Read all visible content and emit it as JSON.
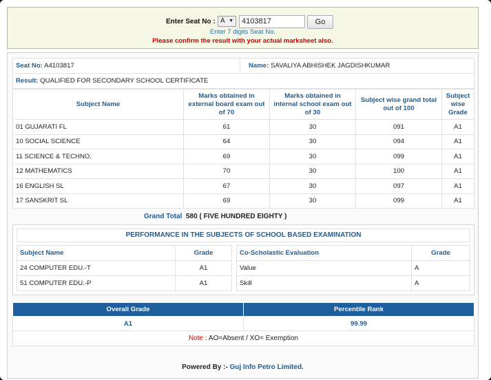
{
  "search": {
    "label": "Enter Seat No :",
    "series_selected": "A",
    "seat_value": "4103817",
    "go_label": "Go",
    "hint": "Enter 7 digits Seat No.",
    "warning": "Please confirm the result with your actual marksheet also."
  },
  "student": {
    "seat_label": "Seat No:",
    "seat_no": "A4103817",
    "name_label": "Name:",
    "name": "SAVALIYA ABHISHEK JAGDISHKUMAR",
    "result_label": "Result:",
    "result": "QUALIFIED FOR SECONDARY SCHOOL CERTIFICATE"
  },
  "marks": {
    "headers": [
      "Subject Name",
      "Marks obtained in external board exam out of 70",
      "Marks obtained in internal school exam out of 30",
      "Subject wise grand total out of 100",
      "Subject wise Grade"
    ],
    "rows": [
      {
        "subject": "01 GUJARATI FL",
        "external": "61",
        "internal": "30",
        "total": "091",
        "grade": "A1"
      },
      {
        "subject": "10 SOCIAL SCIENCE",
        "external": "64",
        "internal": "30",
        "total": "094",
        "grade": "A1"
      },
      {
        "subject": "11 SCIENCE & TECHNO.",
        "external": "69",
        "internal": "30",
        "total": "099",
        "grade": "A1"
      },
      {
        "subject": "12 MATHEMATICS",
        "external": "70",
        "internal": "30",
        "total": "100",
        "grade": "A1"
      },
      {
        "subject": "16 ENGLISH SL",
        "external": "67",
        "internal": "30",
        "total": "097",
        "grade": "A1"
      },
      {
        "subject": "17 SANSKRIT SL",
        "external": "69",
        "internal": "30",
        "total": "099",
        "grade": "A1"
      }
    ],
    "grand_total_label": "Grand Total",
    "grand_total": "580 ( FIVE HUNDRED EIGHTY )"
  },
  "school_based": {
    "title": "PERFORMANCE IN THE SUBJECTS OF SCHOOL BASED EXAMINATION",
    "subject_header": "Subject Name",
    "grade_header": "Grade",
    "subjects": [
      {
        "name": "24 COMPUTER EDU.-T",
        "grade": "A1"
      },
      {
        "name": "51 COMPUTER EDU.-P",
        "grade": "A1"
      }
    ],
    "co_header": "Co-Scholastic Evaluation",
    "co_grade_header": "Grade",
    "co_items": [
      {
        "name": "Value",
        "grade": "A"
      },
      {
        "name": "Skill",
        "grade": "A"
      }
    ]
  },
  "summary": {
    "overall_label": "Overall Grade",
    "overall_value": "A1",
    "percentile_label": "Percentile Rank",
    "percentile_value": "99.99",
    "note_label": "Note",
    "note_text": " : AO=Absent / XO= Exemption"
  },
  "footer": {
    "prefix": "Powered By :- ",
    "link": "Guj Info Petro Limited."
  }
}
